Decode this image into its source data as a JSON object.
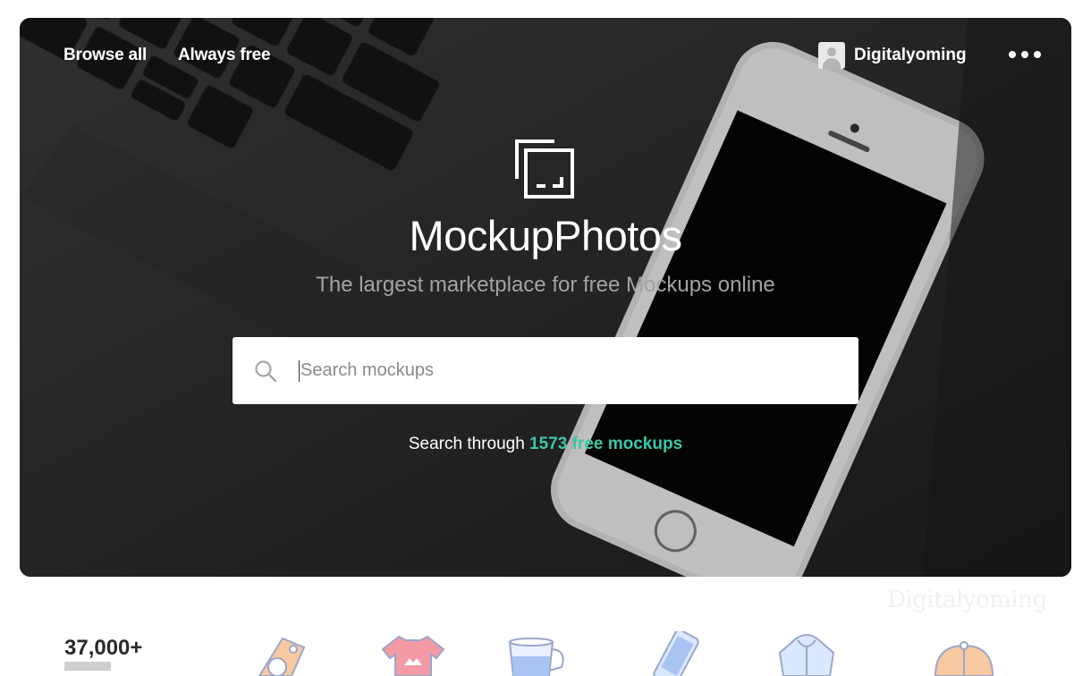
{
  "nav": {
    "browse_all": "Browse all",
    "always_free": "Always free"
  },
  "user": {
    "name": "Digitalyoming",
    "more_icon": "more-horizontal-icon"
  },
  "hero": {
    "logo_icon": "mockup-photos-logo-icon",
    "brand": "MockupPhotos",
    "tagline": "The largest marketplace for free Mockups online"
  },
  "search": {
    "placeholder": "Search mockups",
    "value": "",
    "icon": "search-icon"
  },
  "count_line": {
    "prefix": "Search through ",
    "link": "1573 free mockups"
  },
  "watermark": "Digitalyoming",
  "stats": {
    "number": "37,000+"
  },
  "categories": [
    {
      "icon": "price-tag-icon"
    },
    {
      "icon": "tshirt-icon"
    },
    {
      "icon": "mug-icon"
    },
    {
      "icon": "phone-icon"
    },
    {
      "icon": "hoodie-icon"
    },
    {
      "icon": "cap-icon"
    }
  ],
  "colors": {
    "accent": "#3bc7a5",
    "hero_bg": "#262626",
    "text_white": "#ffffff",
    "tagline": "#a3a3a3"
  }
}
